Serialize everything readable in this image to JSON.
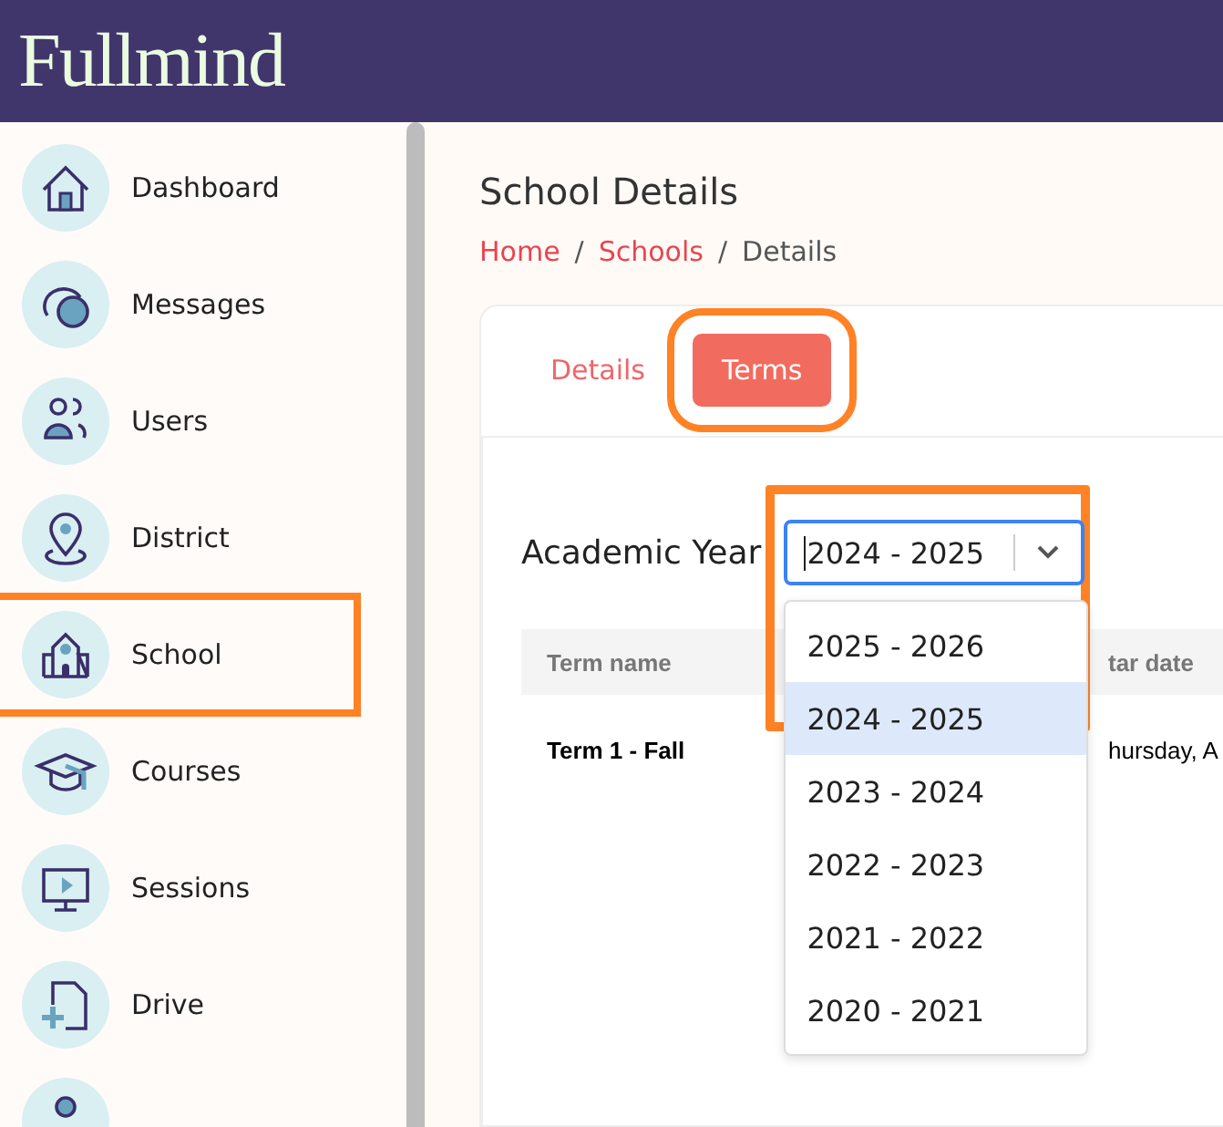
{
  "header": {
    "logo": "Fullmind"
  },
  "sidebar": {
    "items": [
      {
        "kind": "home",
        "label": "Dashboard",
        "highlighted": false
      },
      {
        "kind": "chat",
        "label": "Messages",
        "highlighted": false
      },
      {
        "kind": "users",
        "label": "Users",
        "highlighted": false
      },
      {
        "kind": "pin",
        "label": "District",
        "highlighted": false
      },
      {
        "kind": "school",
        "label": "School",
        "highlighted": true
      },
      {
        "kind": "cap",
        "label": "Courses",
        "highlighted": false
      },
      {
        "kind": "screen",
        "label": "Sessions",
        "highlighted": false
      },
      {
        "kind": "file",
        "label": "Drive",
        "highlighted": false
      }
    ]
  },
  "page": {
    "title": "School Details",
    "breadcrumb": [
      {
        "label": "Home",
        "link": true
      },
      {
        "label": "Schools",
        "link": true
      },
      {
        "label": "Details",
        "link": false
      }
    ],
    "separator": "/"
  },
  "tabs": [
    {
      "label": "Details",
      "selected": false,
      "highlighted": false
    },
    {
      "label": "Terms",
      "selected": true,
      "highlighted": true
    }
  ],
  "year_select": {
    "label": "Academic Year",
    "value": "2024 - 2025",
    "highlighted": true,
    "options": [
      {
        "label": "2025 - 2026",
        "selected": false
      },
      {
        "label": "2024 - 2025",
        "selected": true
      },
      {
        "label": "2023 - 2024",
        "selected": false
      },
      {
        "label": "2022 - 2023",
        "selected": false
      },
      {
        "label": "2021 - 2022",
        "selected": false
      },
      {
        "label": "2020 - 2021",
        "selected": false
      }
    ]
  },
  "table": {
    "columns": [
      "Term name",
      "tar date"
    ],
    "rows": [
      [
        "Term 1 - Fall",
        "hursday, A"
      ]
    ]
  }
}
